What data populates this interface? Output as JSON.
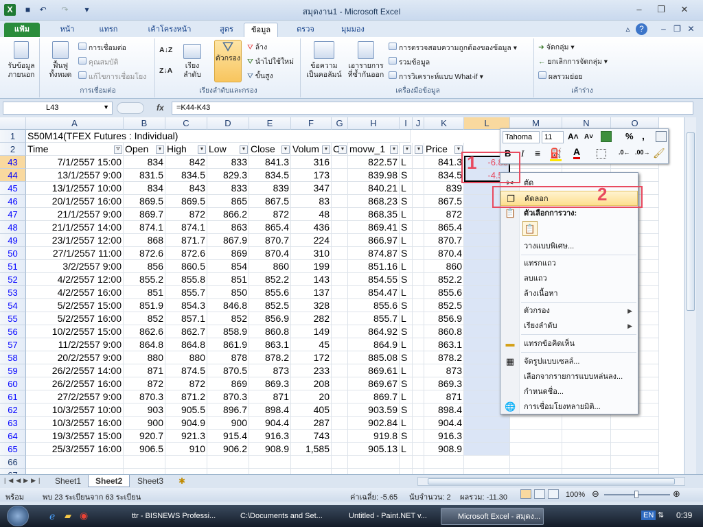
{
  "window": {
    "title": "สมุดงาน1 - Microsoft Excel"
  },
  "tabs": [
    "แฟ้ม",
    "หน้าแรก",
    "แทรก",
    "เค้าโครงหน้ากระดาษ",
    "สูตร",
    "ข้อมูล",
    "ตรวจทาน",
    "มุมมอง"
  ],
  "ribbon": {
    "get_external": "รับข้อมูลภายนอก",
    "refresh_all": "ฟื้นฟูทั้งหมด",
    "connections": "การเชื่อมต่อ",
    "properties": "คุณสมบัติ",
    "edit_links": "แก้ไขการเชื่อมโยง",
    "group_connections": "การเชื่อมต่อ",
    "sort": "เรียงลำดับ",
    "filter": "ตัวกรอง",
    "clear": "ล้าง",
    "reapply": "นำไปใช้ใหม่",
    "advanced": "ขั้นสูง",
    "group_sortfilter": "เรียงลำดับและกรอง",
    "text_to_columns": "ข้อความเป็นคอลัมน์",
    "remove_duplicates": "เอารายการที่ซ้ำกันออก",
    "data_validation": "การตรวจสอบความถูกต้องของข้อมูล",
    "consolidate": "รวมข้อมูล",
    "whatif": "การวิเคราะห์แบบ What-if",
    "group_datatools": "เครื่องมือข้อมูล",
    "group_btn": "จัดกลุ่ม",
    "ungroup": "ยกเลิกการจัดกลุ่ม",
    "subtotal": "ผลรวมย่อย",
    "group_outline": "เค้าร่าง"
  },
  "formula_bar": {
    "name_box": "L43",
    "fx": "fx",
    "formula": "=K44-K43"
  },
  "columns": [
    "A",
    "B",
    "C",
    "D",
    "E",
    "F",
    "G",
    "H",
    "I",
    "J",
    "K",
    "L",
    "M",
    "N",
    "O"
  ],
  "title_cell": "S50M14(TFEX Futures : Individual)",
  "headers": [
    "Time",
    "Open",
    "High",
    "Low",
    "Close",
    "Volum",
    "C",
    "movw_1",
    "",
    "",
    "Price"
  ],
  "rows": [
    {
      "r": "43",
      "a": "7/1/2557 15:00",
      "b": "834",
      "c": "842",
      "d": "833",
      "e": "841.3",
      "f": "316",
      "h": "822.57",
      "i": "L",
      "k": "841.3",
      "l": "-6.80"
    },
    {
      "r": "44",
      "a": "13/1/2557 9:00",
      "b": "831.5",
      "c": "834.5",
      "d": "829.3",
      "e": "834.5",
      "f": "173",
      "h": "839.98",
      "i": "S",
      "k": "834.5",
      "l": "-4.50"
    },
    {
      "r": "45",
      "a": "13/1/2557 10:00",
      "b": "834",
      "c": "843",
      "d": "833",
      "e": "839",
      "f": "347",
      "h": "840.21",
      "i": "L",
      "k": "839",
      "l": ""
    },
    {
      "r": "46",
      "a": "20/1/2557 16:00",
      "b": "869.5",
      "c": "869.5",
      "d": "865",
      "e": "867.5",
      "f": "83",
      "h": "868.23",
      "i": "S",
      "k": "867.5",
      "l": ""
    },
    {
      "r": "47",
      "a": "21/1/2557 9:00",
      "b": "869.7",
      "c": "872",
      "d": "866.2",
      "e": "872",
      "f": "48",
      "h": "868.35",
      "i": "L",
      "k": "872",
      "l": ""
    },
    {
      "r": "48",
      "a": "21/1/2557 14:00",
      "b": "874.1",
      "c": "874.1",
      "d": "863",
      "e": "865.4",
      "f": "436",
      "h": "869.41",
      "i": "S",
      "k": "865.4",
      "l": ""
    },
    {
      "r": "49",
      "a": "23/1/2557 12:00",
      "b": "868",
      "c": "871.7",
      "d": "867.9",
      "e": "870.7",
      "f": "224",
      "h": "866.97",
      "i": "L",
      "k": "870.7",
      "l": ""
    },
    {
      "r": "50",
      "a": "27/1/2557 11:00",
      "b": "872.6",
      "c": "872.6",
      "d": "869",
      "e": "870.4",
      "f": "310",
      "h": "874.87",
      "i": "S",
      "k": "870.4",
      "l": ""
    },
    {
      "r": "51",
      "a": "3/2/2557 9:00",
      "b": "856",
      "c": "860.5",
      "d": "854",
      "e": "860",
      "f": "199",
      "h": "851.16",
      "i": "L",
      "k": "860",
      "l": ""
    },
    {
      "r": "52",
      "a": "4/2/2557 12:00",
      "b": "855.2",
      "c": "855.8",
      "d": "851",
      "e": "852.2",
      "f": "143",
      "h": "854.55",
      "i": "S",
      "k": "852.2",
      "l": ""
    },
    {
      "r": "53",
      "a": "4/2/2557 16:00",
      "b": "851",
      "c": "855.7",
      "d": "850",
      "e": "855.6",
      "f": "137",
      "h": "854.47",
      "i": "L",
      "k": "855.6",
      "l": ""
    },
    {
      "r": "54",
      "a": "5/2/2557 15:00",
      "b": "851.9",
      "c": "854.3",
      "d": "846.8",
      "e": "852.5",
      "f": "328",
      "h": "855.6",
      "i": "S",
      "k": "852.5",
      "l": ""
    },
    {
      "r": "55",
      "a": "5/2/2557 16:00",
      "b": "852",
      "c": "857.1",
      "d": "852",
      "e": "856.9",
      "f": "282",
      "h": "855.7",
      "i": "L",
      "k": "856.9",
      "l": ""
    },
    {
      "r": "56",
      "a": "10/2/2557 15:00",
      "b": "862.6",
      "c": "862.7",
      "d": "858.9",
      "e": "860.8",
      "f": "149",
      "h": "864.92",
      "i": "S",
      "k": "860.8",
      "l": ""
    },
    {
      "r": "57",
      "a": "11/2/2557 9:00",
      "b": "864.8",
      "c": "864.8",
      "d": "861.9",
      "e": "863.1",
      "f": "45",
      "h": "864.9",
      "i": "L",
      "k": "863.1",
      "l": ""
    },
    {
      "r": "58",
      "a": "20/2/2557 9:00",
      "b": "880",
      "c": "880",
      "d": "878",
      "e": "878.2",
      "f": "172",
      "h": "885.08",
      "i": "S",
      "k": "878.2",
      "l": ""
    },
    {
      "r": "59",
      "a": "26/2/2557 14:00",
      "b": "871",
      "c": "874.5",
      "d": "870.5",
      "e": "873",
      "f": "233",
      "h": "869.61",
      "i": "L",
      "k": "873",
      "l": ""
    },
    {
      "r": "60",
      "a": "26/2/2557 16:00",
      "b": "872",
      "c": "872",
      "d": "869",
      "e": "869.3",
      "f": "208",
      "h": "869.67",
      "i": "S",
      "k": "869.3",
      "l": ""
    },
    {
      "r": "61",
      "a": "27/2/2557 9:00",
      "b": "870.3",
      "c": "871.2",
      "d": "870.3",
      "e": "871",
      "f": "20",
      "h": "869.7",
      "i": "L",
      "k": "871",
      "l": ""
    },
    {
      "r": "62",
      "a": "10/3/2557 10:00",
      "b": "903",
      "c": "905.5",
      "d": "896.7",
      "e": "898.4",
      "f": "405",
      "h": "903.59",
      "i": "S",
      "k": "898.4",
      "l": ""
    },
    {
      "r": "63",
      "a": "10/3/2557 16:00",
      "b": "900",
      "c": "904.9",
      "d": "900",
      "e": "904.4",
      "f": "287",
      "h": "902.84",
      "i": "L",
      "k": "904.4",
      "l": ""
    },
    {
      "r": "64",
      "a": "19/3/2557 15:00",
      "b": "920.7",
      "c": "921.3",
      "d": "915.4",
      "e": "916.3",
      "f": "743",
      "h": "919.8",
      "i": "S",
      "k": "916.3",
      "l": ""
    },
    {
      "r": "65",
      "a": "25/3/2557 16:00",
      "b": "906.5",
      "c": "910",
      "d": "906.2",
      "e": "908.9",
      "f": "1,585",
      "h": "905.13",
      "i": "L",
      "k": "908.9",
      "l": ""
    }
  ],
  "extra_rows": [
    "66",
    "67"
  ],
  "mini_toolbar": {
    "font": "Tahoma",
    "size": "11",
    "percent": "%",
    "comma": ","
  },
  "context_menu": [
    {
      "label": "ตัด",
      "icon": "scissors-icon"
    },
    {
      "label": "คัดลอก",
      "icon": "copy-icon"
    },
    {
      "label": "ตัวเลือกการวาง:",
      "icon": "paste-icon"
    },
    {
      "label": "วางแบบพิเศษ..."
    },
    {
      "label": "แทรกแถว"
    },
    {
      "label": "ลบแถว"
    },
    {
      "label": "ล้างเนื้อหา"
    },
    {
      "label": "ตัวกรอง"
    },
    {
      "label": "เรียงลำดับ"
    },
    {
      "label": "แทรกข้อคิดเห็น",
      "icon": "comment-icon"
    },
    {
      "label": "จัดรูปแบบเซลล์...",
      "icon": "format-cells-icon"
    },
    {
      "label": "เลือกจากรายการแบบหล่นลง..."
    },
    {
      "label": "กำหนดชื่อ..."
    },
    {
      "label": "การเชื่อมโยงหลายมิติ...",
      "icon": "hyperlink-icon"
    }
  ],
  "annotations": {
    "one": "1",
    "two": "2",
    "accent": "#e84a5f"
  },
  "sheets": [
    "Sheet1",
    "Sheet2",
    "Sheet3"
  ],
  "status": {
    "ready": "พร้อม",
    "filter_info": "พบ 23 ระเบียนจาก 63 ระเบียน",
    "average": "ค่าเฉลี่ย: -5.65",
    "count": "นับจำนวน: 2",
    "sum": "ผลรวม: -11.30",
    "zoom": "100%"
  },
  "taskbar": {
    "items": [
      "ttr - BISNEWS Professi...",
      "C:\\Documents and Set...",
      "Untitled - Paint.NET v...",
      "Microsoft Excel - สมุดง..."
    ],
    "lang": "EN",
    "clock": "0:39"
  }
}
